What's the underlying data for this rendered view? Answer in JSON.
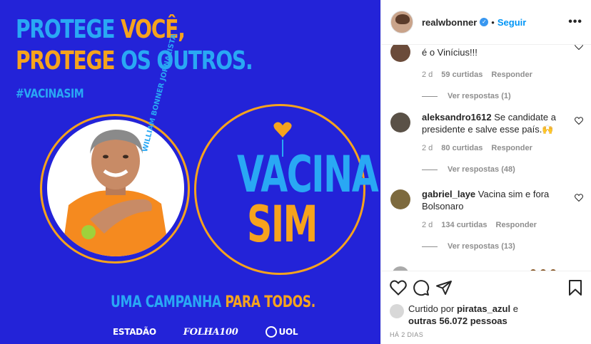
{
  "post": {
    "headline_line1_a": "PROTEGE",
    "headline_line1_b": "VOCÊ,",
    "headline_line2_a": "PROTEGE",
    "headline_line2_b": "OS OUTROS.",
    "hashtag": "#VACINASIM",
    "vacina": "VACINA",
    "sim": "SIM",
    "circle_caption": "WILLIAM BONNER JORNALISTA",
    "campaign_a": "UMA CAMPANHA",
    "campaign_b": "PARA TODOS.",
    "logos": [
      "ESTADÃO",
      "FOLHA100",
      "UOL"
    ],
    "colors": {
      "background": "#2323d8",
      "blue": "#29a8f4",
      "orange": "#f6a31d"
    }
  },
  "header": {
    "username": "realwbonner",
    "separator": "•",
    "follow_label": "Seguir",
    "more_label": "•••"
  },
  "comments": [
    {
      "username": "",
      "text": "é o Vinícius!!!",
      "time": "2 d",
      "likes": "59 curtidas",
      "reply": "Responder",
      "replies": "Ver respostas (1)"
    },
    {
      "username": "aleksandro1612",
      "text": "Se candidate a presidente e salve esse país.🙌",
      "time": "2 d",
      "likes": "80 curtidas",
      "reply": "Responder",
      "replies": "Ver respostas (48)"
    },
    {
      "username": "gabriel_laye",
      "text": "Vacina sim e fora Bolsonaro",
      "time": "2 d",
      "likes": "134 curtidas",
      "reply": "Responder",
      "replies": "Ver respostas (13)"
    }
  ],
  "likes": {
    "prefix": "Curtido por",
    "user": "piratas_azul",
    "middle": "e",
    "others": "outras 56.072 pessoas"
  },
  "timestamp": "HÁ 2 DIAS"
}
